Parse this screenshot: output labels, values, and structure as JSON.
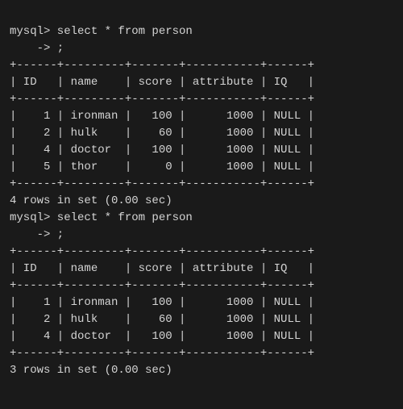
{
  "terminal": {
    "bg": "#1a1a1a",
    "fg": "#d4d4d4",
    "sections": [
      {
        "id": "section1",
        "prompt_line": "mysql> select * from person",
        "continuation": "    -> ;",
        "separator_top": "+------+---------+-------+-----------+------+",
        "header": "| ID   | name    | score | attribute | IQ   |",
        "separator_mid": "+------+---------+-------+-----------+------+",
        "rows": [
          "|    1 | ironman |   100 |      1000 | NULL |",
          "|    2 | hulk    |    60 |      1000 | NULL |",
          "|    4 | doctor  |   100 |      1000 | NULL |",
          "|    5 | thor    |     0 |      1000 | NULL |"
        ],
        "separator_bot": "+------+---------+-------+-----------+------+",
        "result": "4 rows in set (0.00 sec)"
      },
      {
        "id": "section2",
        "prompt_line": "mysql> select * from person",
        "continuation": "    -> ;",
        "separator_top": "+------+---------+-------+-----------+------+",
        "header": "| ID   | name    | score | attribute | IQ   |",
        "separator_mid": "+------+---------+-------+-----------+------+",
        "rows": [
          "|    1 | ironman |   100 |      1000 | NULL |",
          "|    2 | hulk    |    60 |      1000 | NULL |",
          "|    4 | doctor  |   100 |      1000 | NULL |"
        ],
        "separator_bot": "+------+---------+-------+-----------+------+",
        "result": "3 rows in set (0.00 sec)"
      }
    ]
  }
}
